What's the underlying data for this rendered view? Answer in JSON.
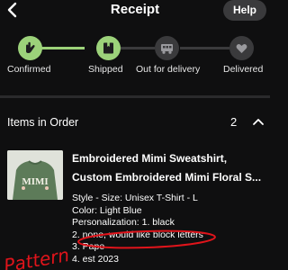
{
  "header": {
    "title": "Receipt",
    "help_label": "Help",
    "back_icon": "chevron-left-icon"
  },
  "tracker": {
    "steps": [
      {
        "label": "Confirmed",
        "state": "done",
        "icon": "hand-icon"
      },
      {
        "label": "Shipped",
        "state": "done",
        "icon": "package-icon"
      },
      {
        "label": "Out for delivery",
        "state": "pending",
        "icon": "truck-icon"
      },
      {
        "label": "Delivered",
        "state": "pending",
        "icon": "heart-box-icon"
      }
    ],
    "done_color": "#9cd27a",
    "pending_color": "#3a3a3c"
  },
  "items": {
    "header_label": "Items in Order",
    "count": "2"
  },
  "product": {
    "title_line1": "Embroidered Mimi Sweatshirt,",
    "title_line2": "Custom Embroidered Mimi Floral S...",
    "thumb_text": "MIMI",
    "details": [
      "Style - Size: Unisex T-Shirt - L",
      "Color: Light Blue",
      "Personalization: 1. black",
      "2. none, would like block letters",
      "3. Pape",
      "4. est 2023"
    ]
  },
  "annotation": {
    "text": "Pattern",
    "color": "#e0141b"
  }
}
